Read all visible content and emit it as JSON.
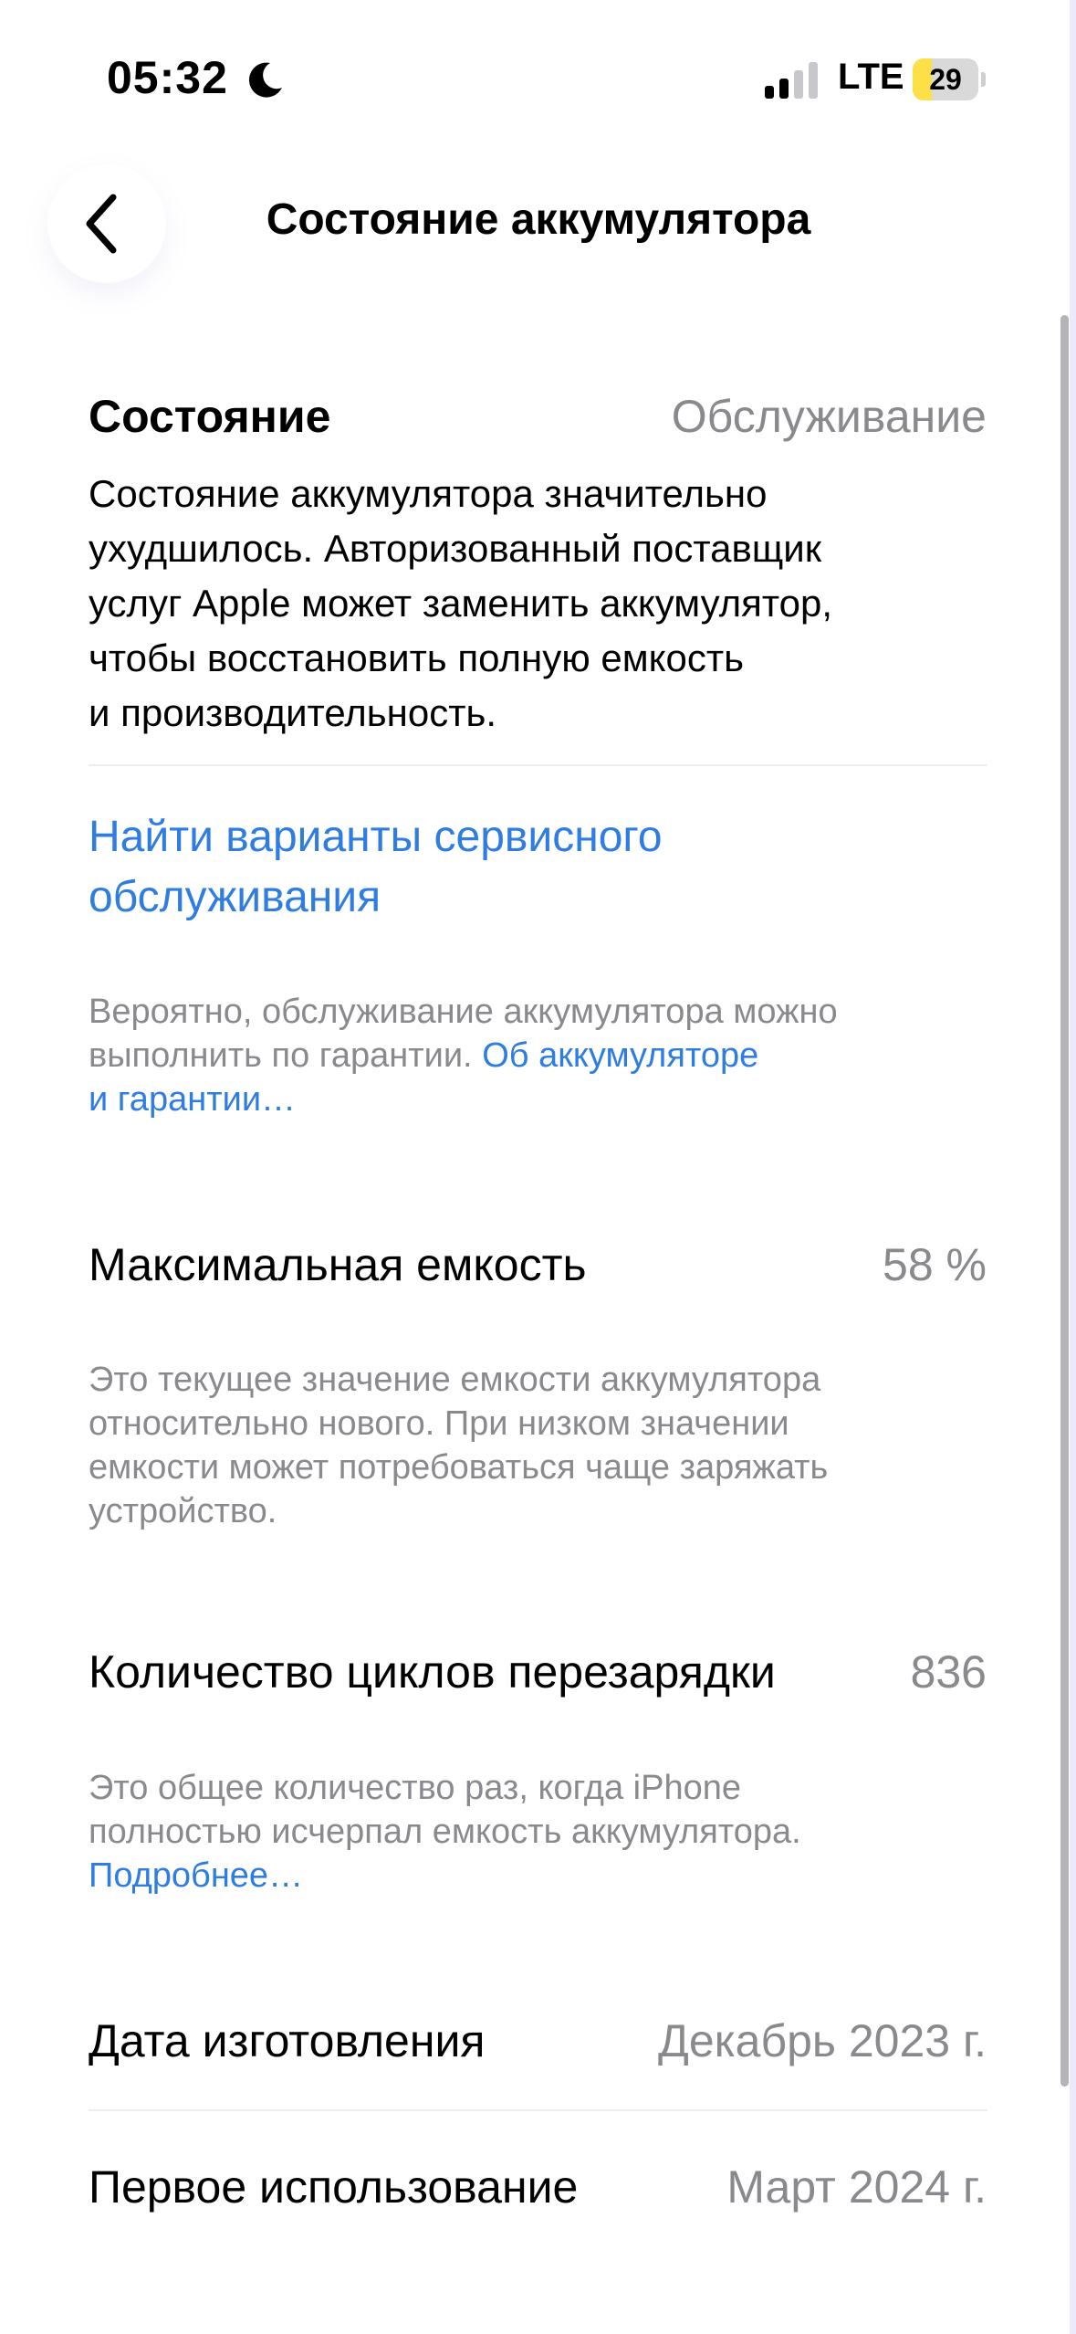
{
  "status_bar": {
    "time": "05:32",
    "network": "LTE",
    "battery_level": "29",
    "battery_fraction": 0.29,
    "battery_color": "#fde047"
  },
  "nav": {
    "title": "Состояние аккумулятора",
    "back_icon": "chevron-left-icon"
  },
  "health": {
    "label": "Состояние",
    "value": "Обслуживание",
    "description_lines": [
      "Состояние аккумулятора значительно",
      "ухудшилось. Авторизованный поставщик",
      "услуг Apple может заменить аккумулятор,",
      "чтобы восстановить полную емкость",
      "и производительность."
    ],
    "service_link_lines": [
      "Найти варианты сервисного",
      "обслуживания"
    ],
    "footnote_line1": "Вероятно, обслуживание аккумулятора можно",
    "footnote_line2_text": "выполнить по гарантии. ",
    "footnote_link_part1": "Об аккумуляторе",
    "footnote_link_part2": "и гарантии…"
  },
  "max_capacity": {
    "label": "Максимальная емкость",
    "value": "58 %",
    "footnote_lines": [
      "Это текущее значение емкости аккумулятора",
      "относительно нового. При низком значении",
      "емкости может потребоваться чаще заряжать",
      "устройство."
    ]
  },
  "cycle_count": {
    "label": "Количество циклов перезарядки",
    "value": "836",
    "footnote_lines": [
      "Это общее количество раз, когда iPhone",
      "полностью исчерпал емкость аккумулятора."
    ],
    "footnote_link": "Подробнее…"
  },
  "manufacture_date": {
    "label": "Дата изготовления",
    "value": "Декабрь 2023 г."
  },
  "first_use": {
    "label": "Первое использование",
    "value": "Март 2024 г."
  },
  "colors": {
    "link": "#2f7de1",
    "secondary_text": "#8a8a8e"
  }
}
